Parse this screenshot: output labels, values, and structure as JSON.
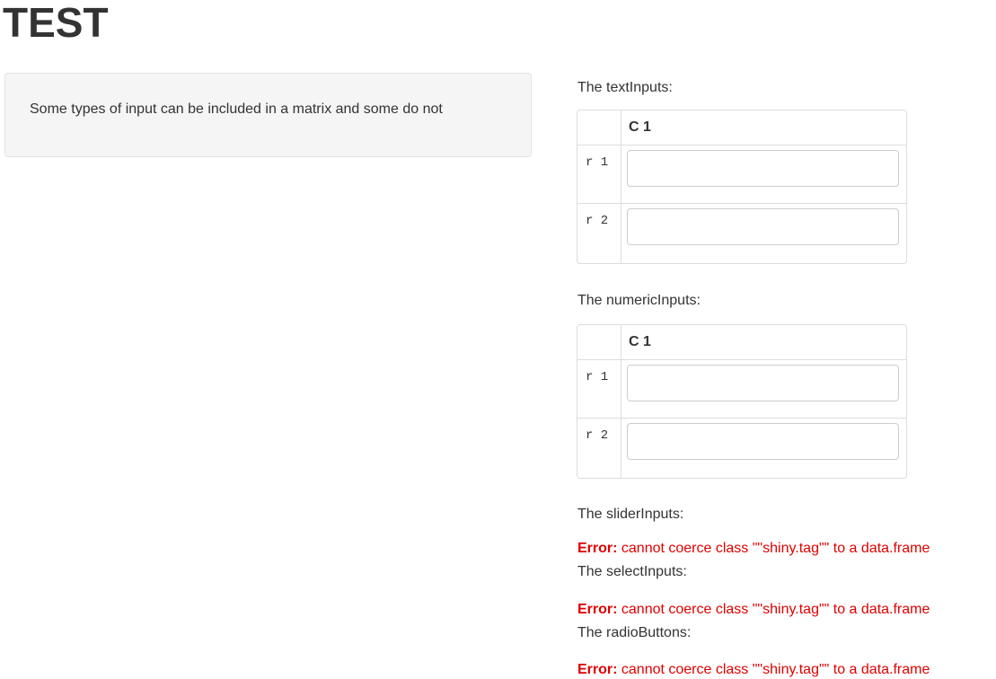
{
  "page": {
    "title": "TEST"
  },
  "sidebar": {
    "text": "Some types of input can be included in a matrix and some do not"
  },
  "sections": {
    "text_inputs": {
      "label": "The textInputs:",
      "column_header": "C 1",
      "rows": [
        {
          "label": "r 1",
          "value": ""
        },
        {
          "label": "r 2",
          "value": ""
        }
      ]
    },
    "numeric_inputs": {
      "label": "The numericInputs:",
      "column_header": "C 1",
      "rows": [
        {
          "label": "r 1",
          "value": ""
        },
        {
          "label": "r 2",
          "value": ""
        }
      ]
    },
    "slider_inputs": {
      "label": "The sliderInputs:",
      "error_prefix": "Error:",
      "error_message": " cannot coerce class \"\"shiny.tag\"\" to a data.frame"
    },
    "select_inputs": {
      "label": "The selectInputs:",
      "error_prefix": "Error:",
      "error_message": " cannot coerce class \"\"shiny.tag\"\" to a data.frame"
    },
    "radio_buttons": {
      "label": "The radioButtons:",
      "error_prefix": "Error:",
      "error_message": " cannot coerce class \"\"shiny.tag\"\" to a data.frame"
    }
  },
  "colors": {
    "error": "#e00000",
    "panel_bg": "#f5f5f5",
    "text": "#333333"
  }
}
